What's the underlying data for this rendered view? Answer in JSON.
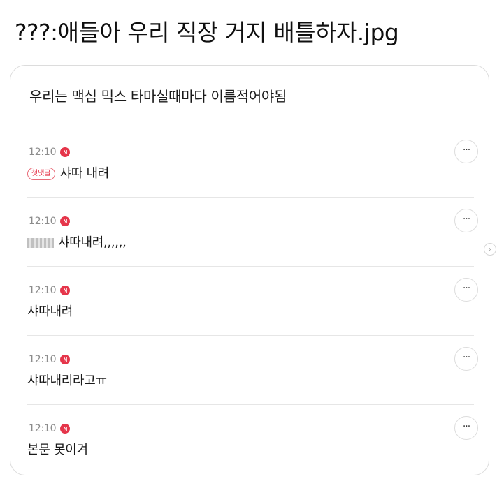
{
  "header": {
    "title": "???:애들아 우리 직장 거지 배틀하자.jpg"
  },
  "post": {
    "title": "우리는 맥심 믹스 타마실때마다 이름적어야됨"
  },
  "badge_label": "N",
  "more_label": "···",
  "side_arrow_label": "›",
  "colors": {
    "badge": "#e5354a",
    "divider": "#e6e6e6",
    "time": "#8c8c8c"
  },
  "comments": [
    {
      "time": "12:10",
      "tag": "첫댓글",
      "text": "샤따 내려"
    },
    {
      "time": "12:10",
      "censored_prefix": "시발",
      "text": "샤따내려,,,,,,"
    },
    {
      "time": "12:10",
      "text": "샤따내려"
    },
    {
      "time": "12:10",
      "text": "샤따내리라고ㅠ"
    },
    {
      "time": "12:10",
      "text": "본문 못이겨"
    }
  ]
}
